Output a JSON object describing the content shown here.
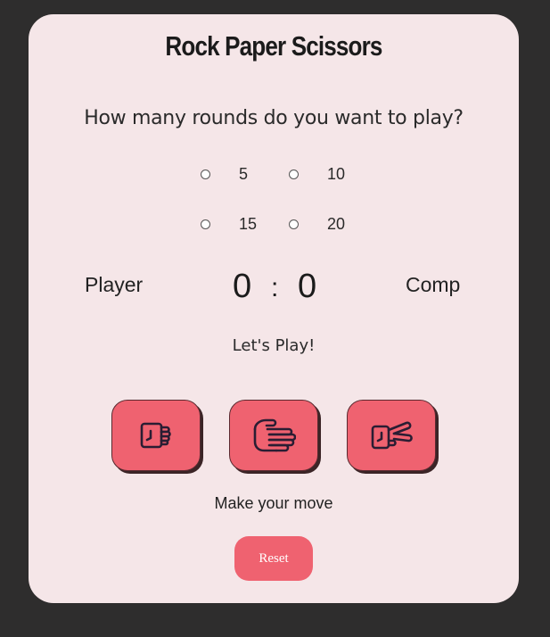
{
  "title": "Rock Paper Scissors",
  "question": "How many rounds do you want to play?",
  "rounds": {
    "options": [
      "5",
      "10",
      "15",
      "20"
    ]
  },
  "scoreboard": {
    "player_label": "Player",
    "comp_label": "Comp",
    "player_score": "0",
    "separator": ":",
    "comp_score": "0"
  },
  "status": "Let's Play!",
  "moves": {
    "rock_icon": "rock-fist-icon",
    "paper_icon": "paper-hand-icon",
    "scissors_icon": "scissors-hand-icon"
  },
  "prompt": "Make your move",
  "reset_label": "Reset",
  "colors": {
    "background": "#2e2d2d",
    "card": "#f5e6e8",
    "accent": "#ef6270",
    "text": "#1b1b1b"
  }
}
